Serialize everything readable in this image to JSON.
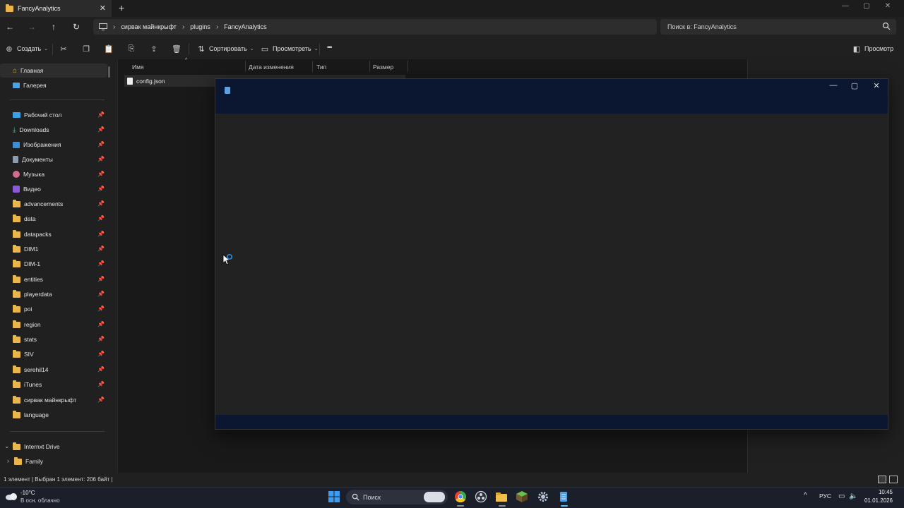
{
  "window": {
    "tab_title": "FancyAnalytics",
    "new_tab": "+",
    "close_tab": "✕"
  },
  "address": {
    "crumbs": [
      "сирвак майнкрыфт",
      "plugins",
      "FancyAnalytics"
    ],
    "search_placeholder": "Поиск в: FancyAnalytics"
  },
  "toolbar": {
    "create_label": "Создать",
    "sort_label": "Сортировать",
    "view_label": "Просмотреть",
    "more_label": "•••",
    "preview_label": "Просмотр"
  },
  "sidebar": {
    "home": "Главная",
    "gallery": "Галерея",
    "items": [
      "Рабочий стол",
      "Downloads",
      "Изображения",
      "Документы",
      "Музыка",
      "Видео",
      "advancements",
      "data",
      "datapacks",
      "DIM1",
      "DIM-1",
      "entities",
      "playerdata",
      "poi",
      "region",
      "stats",
      "SIV",
      "serehil14",
      "iTunes",
      "сирвак майнкрыфт",
      "language"
    ],
    "drive": "Internxt Drive",
    "drive_child": "Family"
  },
  "list": {
    "columns": [
      "Имя",
      "Дата изменения",
      "Тип",
      "Размер"
    ],
    "files": [
      "config.json"
    ]
  },
  "status": {
    "text": "1 элемент  |  Выбран 1 элемент: 206 байт  |"
  },
  "taskbar": {
    "weather_temp": "-10°C",
    "weather_desc": "В осн. облачно",
    "search_label": "Поиск",
    "lang": "РУС",
    "time": "10:45",
    "date": "01.01.2026"
  },
  "colors": {
    "accent": "#4cc2ff",
    "folder": "#e8b64c",
    "popup_bar": "#0b1630"
  }
}
